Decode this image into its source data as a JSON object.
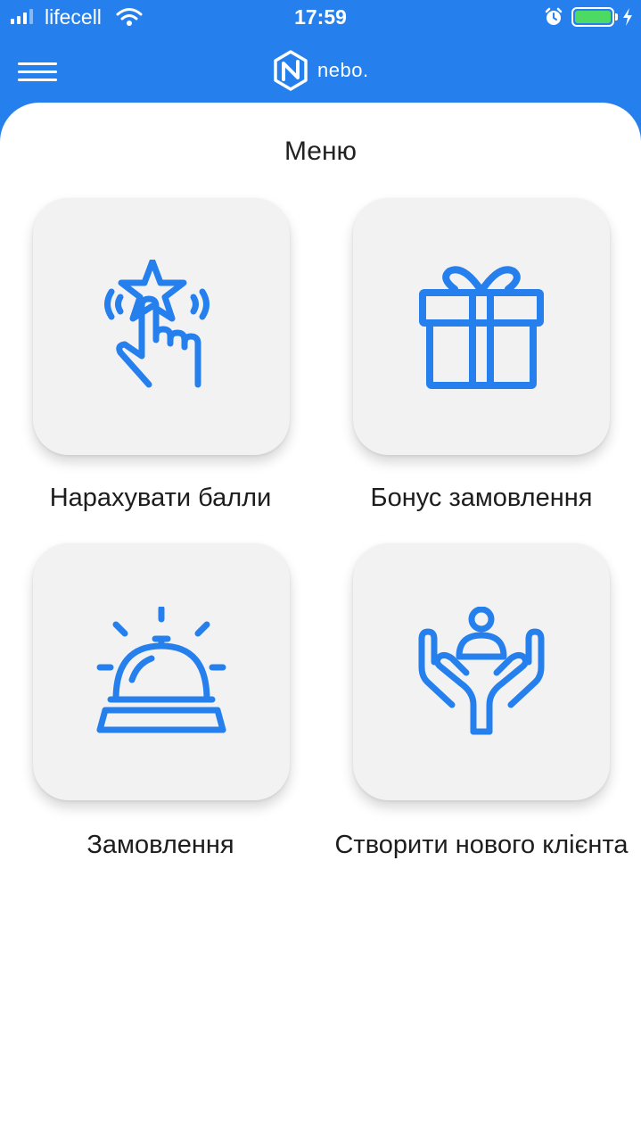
{
  "status_bar": {
    "carrier": "lifecell",
    "time": "17:59",
    "battery_color": "#4CD964",
    "icons": [
      "signal-icon",
      "wifi-icon",
      "alarm-icon",
      "battery-icon",
      "charging-icon"
    ]
  },
  "header": {
    "logo_text": "nebo.",
    "background_color": "#2580EE",
    "menu_icon": "hamburger-icon"
  },
  "page": {
    "title": "Меню"
  },
  "menu": {
    "accent_color": "#2580EE",
    "items": [
      {
        "label": "Нарахувати балли",
        "icon": "star-tap-icon"
      },
      {
        "label": "Бонус замовлення",
        "icon": "gift-icon"
      },
      {
        "label": "Замовлення",
        "icon": "service-bell-icon"
      },
      {
        "label": "Створити нового клієнта",
        "icon": "hands-person-icon"
      }
    ]
  }
}
